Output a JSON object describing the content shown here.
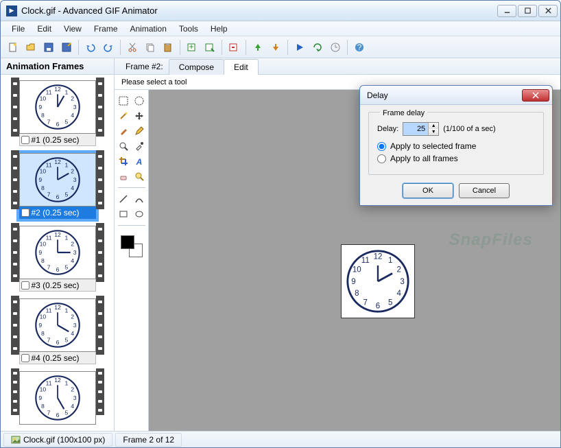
{
  "window": {
    "title": "Clock.gif - Advanced GIF Animator"
  },
  "menu": {
    "file": "File",
    "edit": "Edit",
    "view": "View",
    "frame": "Frame",
    "animation": "Animation",
    "tools": "Tools",
    "help": "Help"
  },
  "sidebar": {
    "header": "Animation Frames",
    "frames": [
      {
        "label": "#1 (0.25 sec)",
        "selected": false
      },
      {
        "label": "#2 (0.25 sec)",
        "selected": true
      },
      {
        "label": "#3 (0.25 sec)",
        "selected": false
      },
      {
        "label": "#4 (0.25 sec)",
        "selected": false
      },
      {
        "label": "",
        "selected": false
      }
    ]
  },
  "tabs": {
    "indicator": "Frame #2:",
    "compose": "Compose",
    "edit": "Edit"
  },
  "tool_hint": "Please select a tool",
  "watermark": "SnapFiles",
  "status": {
    "file": "Clock.gif (100x100 px)",
    "frame": "Frame 2 of 12"
  },
  "dialog": {
    "title": "Delay",
    "legend": "Frame delay",
    "delay_label": "Delay:",
    "delay_value": "25",
    "unit": "(1/100 of a sec)",
    "opt_selected": "Apply to selected frame",
    "opt_all": "Apply to all frames",
    "ok": "OK",
    "cancel": "Cancel"
  }
}
